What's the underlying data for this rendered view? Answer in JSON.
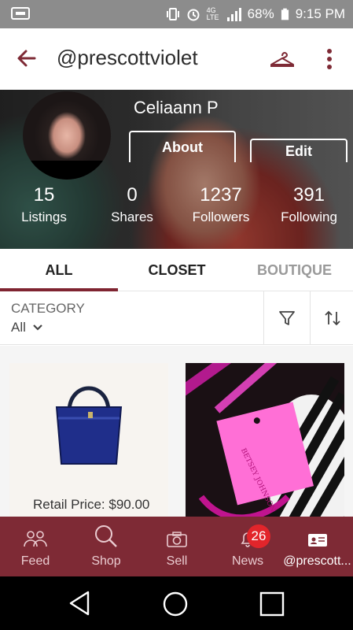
{
  "status_bar": {
    "battery": "68%",
    "time": "9:15 PM",
    "network": "4G LTE"
  },
  "app_bar": {
    "title": "@prescottviolet",
    "icons": [
      "back-arrow-icon",
      "hanger-icon",
      "more-vert-icon"
    ]
  },
  "profile": {
    "name": "Celiaann P",
    "about_label": "About",
    "edit_label": "Edit",
    "stats": [
      {
        "value": "15",
        "label": "Listings"
      },
      {
        "value": "0",
        "label": "Shares"
      },
      {
        "value": "1237",
        "label": "Followers"
      },
      {
        "value": "391",
        "label": "Following"
      }
    ]
  },
  "tabs": [
    {
      "label": "ALL",
      "active": true
    },
    {
      "label": "CLOSET",
      "active": false
    },
    {
      "label": "BOUTIQUE",
      "active": false
    }
  ],
  "filter": {
    "category_label": "CATEGORY",
    "category_value": "All"
  },
  "listings": [
    {
      "retail_price": "Retail Price: $90.00"
    },
    {
      "tag_text": "BETSEY JOHNSON"
    }
  ],
  "bottom_nav": [
    {
      "label": "Feed",
      "icon": "people-icon"
    },
    {
      "label": "Shop",
      "icon": "search-icon"
    },
    {
      "label": "Sell",
      "icon": "camera-icon"
    },
    {
      "label": "News",
      "icon": "bell-icon",
      "badge": "26"
    },
    {
      "label": "@prescott...",
      "icon": "profile-card-icon",
      "active": true
    }
  ],
  "colors": {
    "brand": "#7e2a35",
    "accent": "#7f2431",
    "badge": "#e2252b"
  }
}
